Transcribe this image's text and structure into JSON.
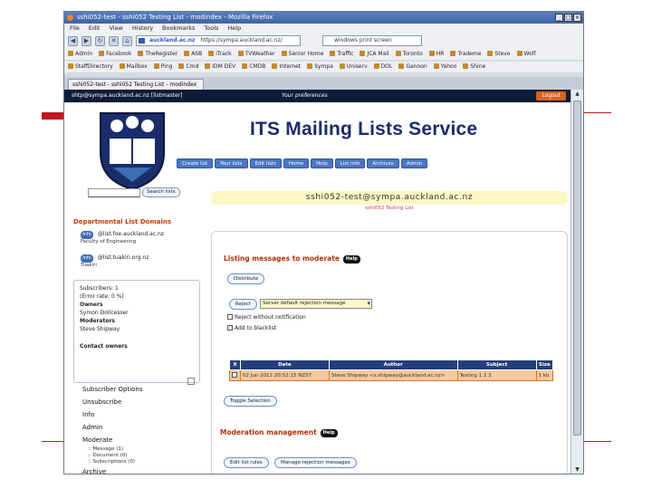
{
  "browser": {
    "window_title": "sshi052-test - sshi052 Testing List - modindex - Mozilla Firefox",
    "menu": [
      "File",
      "Edit",
      "View",
      "History",
      "Bookmarks",
      "Tools",
      "Help"
    ],
    "url": "https://sympa.auckland.ac.nz/",
    "site_label": "auckland.ac.nz",
    "search_value": "windows print screen",
    "bookmarks_row1": [
      "Admin",
      "Facebook",
      "TheRegister",
      "ASB",
      "iTrack",
      "TVWeather",
      "Senior Home",
      "Traffic",
      "JCA Mail",
      "Toronto",
      "HR",
      "Trademe",
      "Steve",
      "Wolf"
    ],
    "bookmarks_row2": [
      "StaffDirectory",
      "Mailbox",
      "Ping",
      "Cmd",
      "IDM DEV",
      "CMDB",
      "Internet",
      "Sympa",
      "Uniserv",
      "DOL",
      "Gannon",
      "Yahoo",
      "Shine"
    ],
    "tab_title": "sshi052-test - sshi052 Testing List - modindex"
  },
  "page": {
    "top_user": "shtp@sympa.auckland.ac.nz [listmaster]",
    "top_pref": "Your preferences",
    "login_label": "Logout",
    "service_title": "ITS Mailing Lists Service",
    "menu_items": [
      "Create list",
      "Your lists",
      "Edit lists",
      "Home",
      "Help",
      "List info",
      "Archives",
      "Admin"
    ],
    "search_button": "Search lists",
    "list_address": "sshi052-test@sympa.auckland.ac.nz",
    "list_subtitle": "sshi052 Testing List",
    "dept_heading": "Departmental List Domains",
    "dept_items": [
      {
        "badge": "Info",
        "domain": "@list.foe.auckland.ac.nz",
        "desc": "Faculty of Engineering"
      },
      {
        "badge": "Info",
        "domain": "@list.tuakiri.org.nz",
        "desc": "Tuakiri"
      }
    ],
    "info_lines": [
      "Subscribers: 1",
      "(Error rate: 0 %)",
      "Owners",
      "Symon Dollcesser",
      "Moderators",
      "Steve Shipway"
    ],
    "contact_owners": "Contact owners",
    "actions": [
      "Subscriber Options",
      "Unsubscribe",
      "Info",
      "Admin",
      "Moderate"
    ],
    "moderate_sub": [
      "Message (1)",
      "Document (0)",
      "Subscriptions (0)"
    ],
    "archive_label": "Archive",
    "section_listing": "Listing messages to moderate",
    "help_label": "Help",
    "distribute_btn": "Distribute",
    "reject_btn": "Reject",
    "reject_select": "Server default rejection message",
    "reject_notify": "Reject without notification",
    "add_blacklist": "Add to blacklist",
    "table_headers": [
      "X",
      "Date",
      "Author",
      "Subject",
      "Size"
    ],
    "table_row": [
      "",
      "02 Jun 2012 20:52:15 NZST",
      "Steve Shipway <s.shipway@auckland.ac.nz>",
      "Testing 1 2 3",
      "1 kb"
    ],
    "toggle_btn": "Toggle Selection",
    "section_moderation": "Moderation management",
    "edit_btn": "Edit list rules",
    "manage_reject_btn": "Manage rejection messages"
  }
}
